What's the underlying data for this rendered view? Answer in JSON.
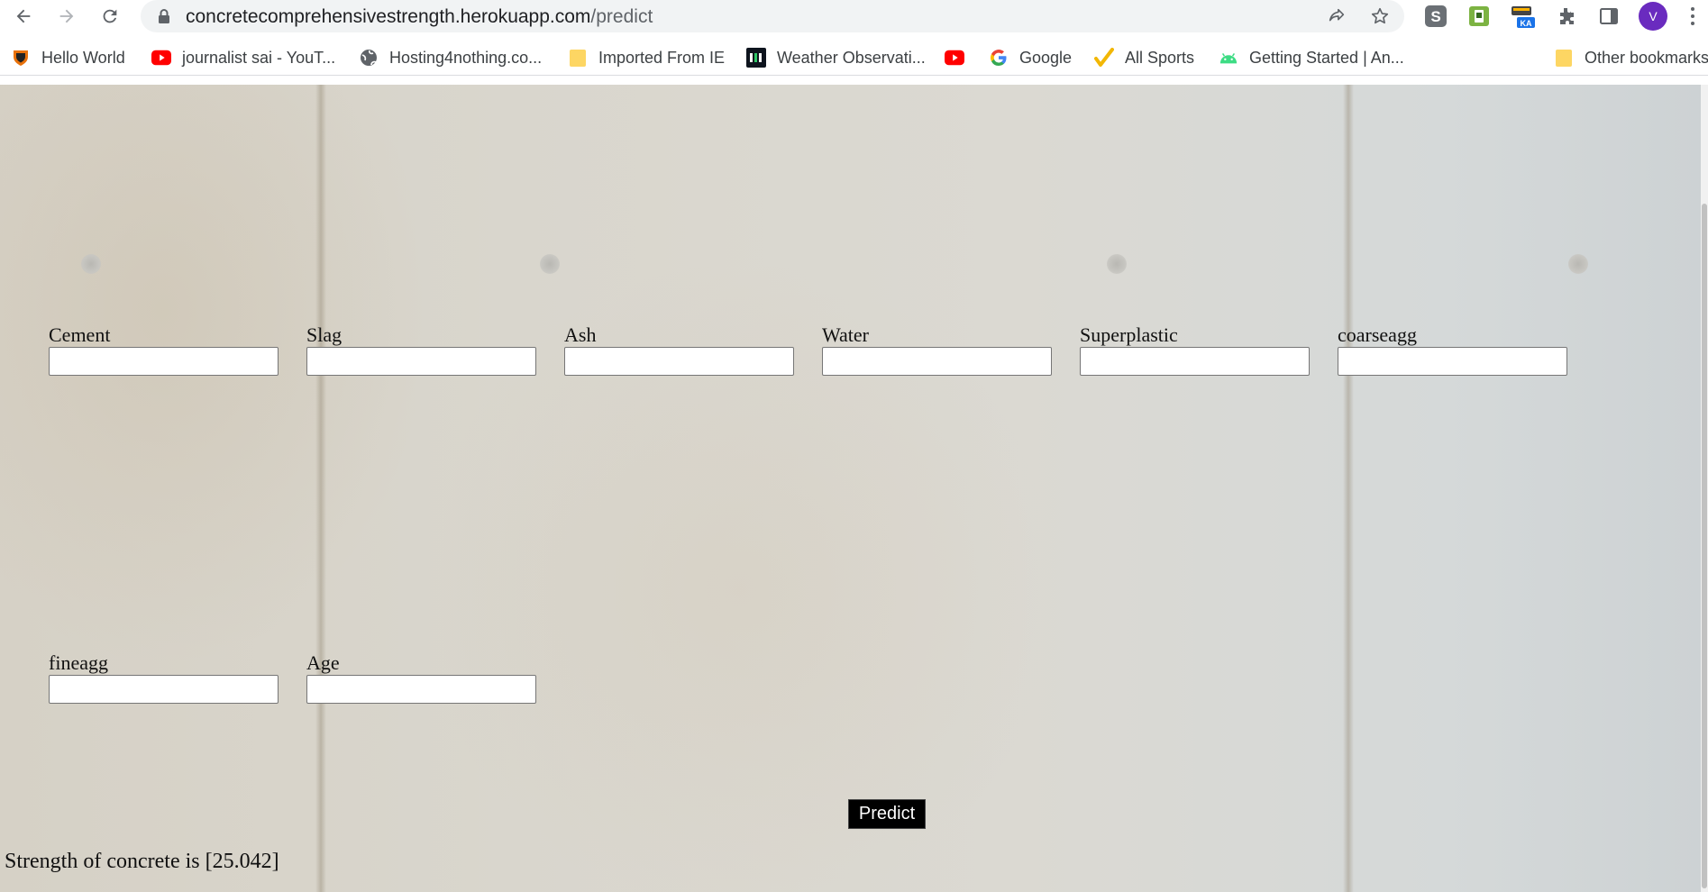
{
  "browser": {
    "url_host": "concretecomprehensivestrength.herokuapp.com",
    "url_path": "/predict",
    "profile_initial": "V",
    "extension_badge": "KA"
  },
  "bookmarks": [
    {
      "label": "Hello World",
      "icon": "shield-crest-icon"
    },
    {
      "label": "journalist sai - YouT...",
      "icon": "youtube-icon"
    },
    {
      "label": "Hosting4nothing.co...",
      "icon": "globe-icon"
    },
    {
      "label": "Imported From IE",
      "icon": "folder-icon"
    },
    {
      "label": "Weather Observati...",
      "icon": "hackerrank-icon"
    },
    {
      "label": "",
      "icon": "youtube-icon"
    },
    {
      "label": "Google",
      "icon": "google-icon"
    },
    {
      "label": "All Sports",
      "icon": "checkmark-icon"
    },
    {
      "label": "Getting Started | An...",
      "icon": "android-icon"
    }
  ],
  "overflow_chevron": "»",
  "other_bookmarks": "Other bookmarks",
  "form": {
    "fields": [
      {
        "label": "Cement",
        "value": ""
      },
      {
        "label": "Slag",
        "value": ""
      },
      {
        "label": "Ash",
        "value": ""
      },
      {
        "label": "Water",
        "value": ""
      },
      {
        "label": "Superplastic",
        "value": ""
      },
      {
        "label": "coarseagg",
        "value": ""
      },
      {
        "label": "fineagg",
        "value": ""
      },
      {
        "label": "Age",
        "value": ""
      }
    ],
    "submit_label": "Predict"
  },
  "result_text": "Strength of concrete is [25.042]",
  "colors": {
    "button_bg": "#000000",
    "button_text": "#ffffff",
    "avatar_bg": "#6a2bbf",
    "youtube_red": "#ff0000"
  }
}
